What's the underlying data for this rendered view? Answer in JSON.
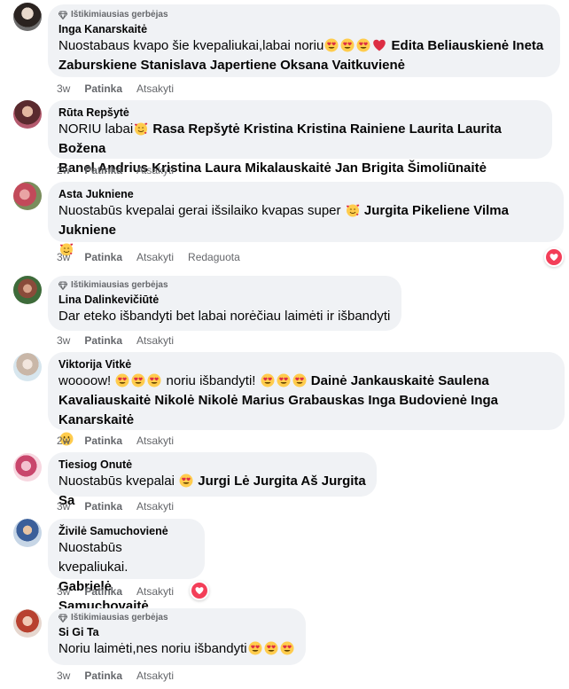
{
  "fan_badge": "Ištikimiausias gerbėjas",
  "actions": {
    "like": "Patinka",
    "reply": "Atsakyti",
    "edited": "Redaguota"
  },
  "comments": [
    {
      "author": "Inga Kanarskaitė",
      "line1": "Nuostabaus kvapo šie kvepaliukai,labai noriu",
      "tag1": "Edita Beliauskienė Ineta",
      "tag2": "Zaburskiene Stanislava Japertiene Oksana Vaitkuvienė",
      "time": "3w"
    },
    {
      "author": "Rūta Repšytė",
      "text1": "NORIU labai",
      "tag1": "Rasa Repšytė Kristina Kristina Rainiene Laurita Laurita Božena",
      "tag2": "Banel Andrius Kristina Laura Mikalauskaitė Jan Brigita Šimoliūnaitė",
      "time": "2w"
    },
    {
      "author": "Asta Jukniene",
      "text1": "Nuostabūs kvepalai gerai išsilaiko kvapas super",
      "tag1": "Jurgita Pikeliene Vilma Jukniene",
      "time": "3w"
    },
    {
      "author": "Lina Dalinkevičiūtė",
      "text1": "Dar eteko išbandyti bet labai norėčiau laimėti ir išbandyti",
      "time": "3w"
    },
    {
      "author": "Viktorija Vitkė",
      "text1": "woooow!",
      "text2": "noriu išbandyti!",
      "tag1": "Dainė Jankauskaitė Saulena",
      "tag2": "Kavaliauskaitė Nikolė Nikolė Marius Grabauskas Inga Budovienė Inga Kanarskaitė",
      "time": "2w"
    },
    {
      "author": "Tiesiog Onutė",
      "text1": "Nuostabūs kvepalai",
      "tag1": "Jurgi Lė Jurgita Aš Jurgita Sa",
      "time": "3w"
    },
    {
      "author": "Živilė Samuchovienė",
      "text1": "Nuostabūs kvepaliukai.",
      "tag1": "Gabrielė Samuchovaitė",
      "time": "3w"
    },
    {
      "author": "Si Gi Ta",
      "text1": "Noriu laimėti,nes noriu išbandyti",
      "time": "3w"
    }
  ],
  "colors": {
    "bubble": "#f0f2f5",
    "meta": "#65676b",
    "love": "#f33e58"
  }
}
